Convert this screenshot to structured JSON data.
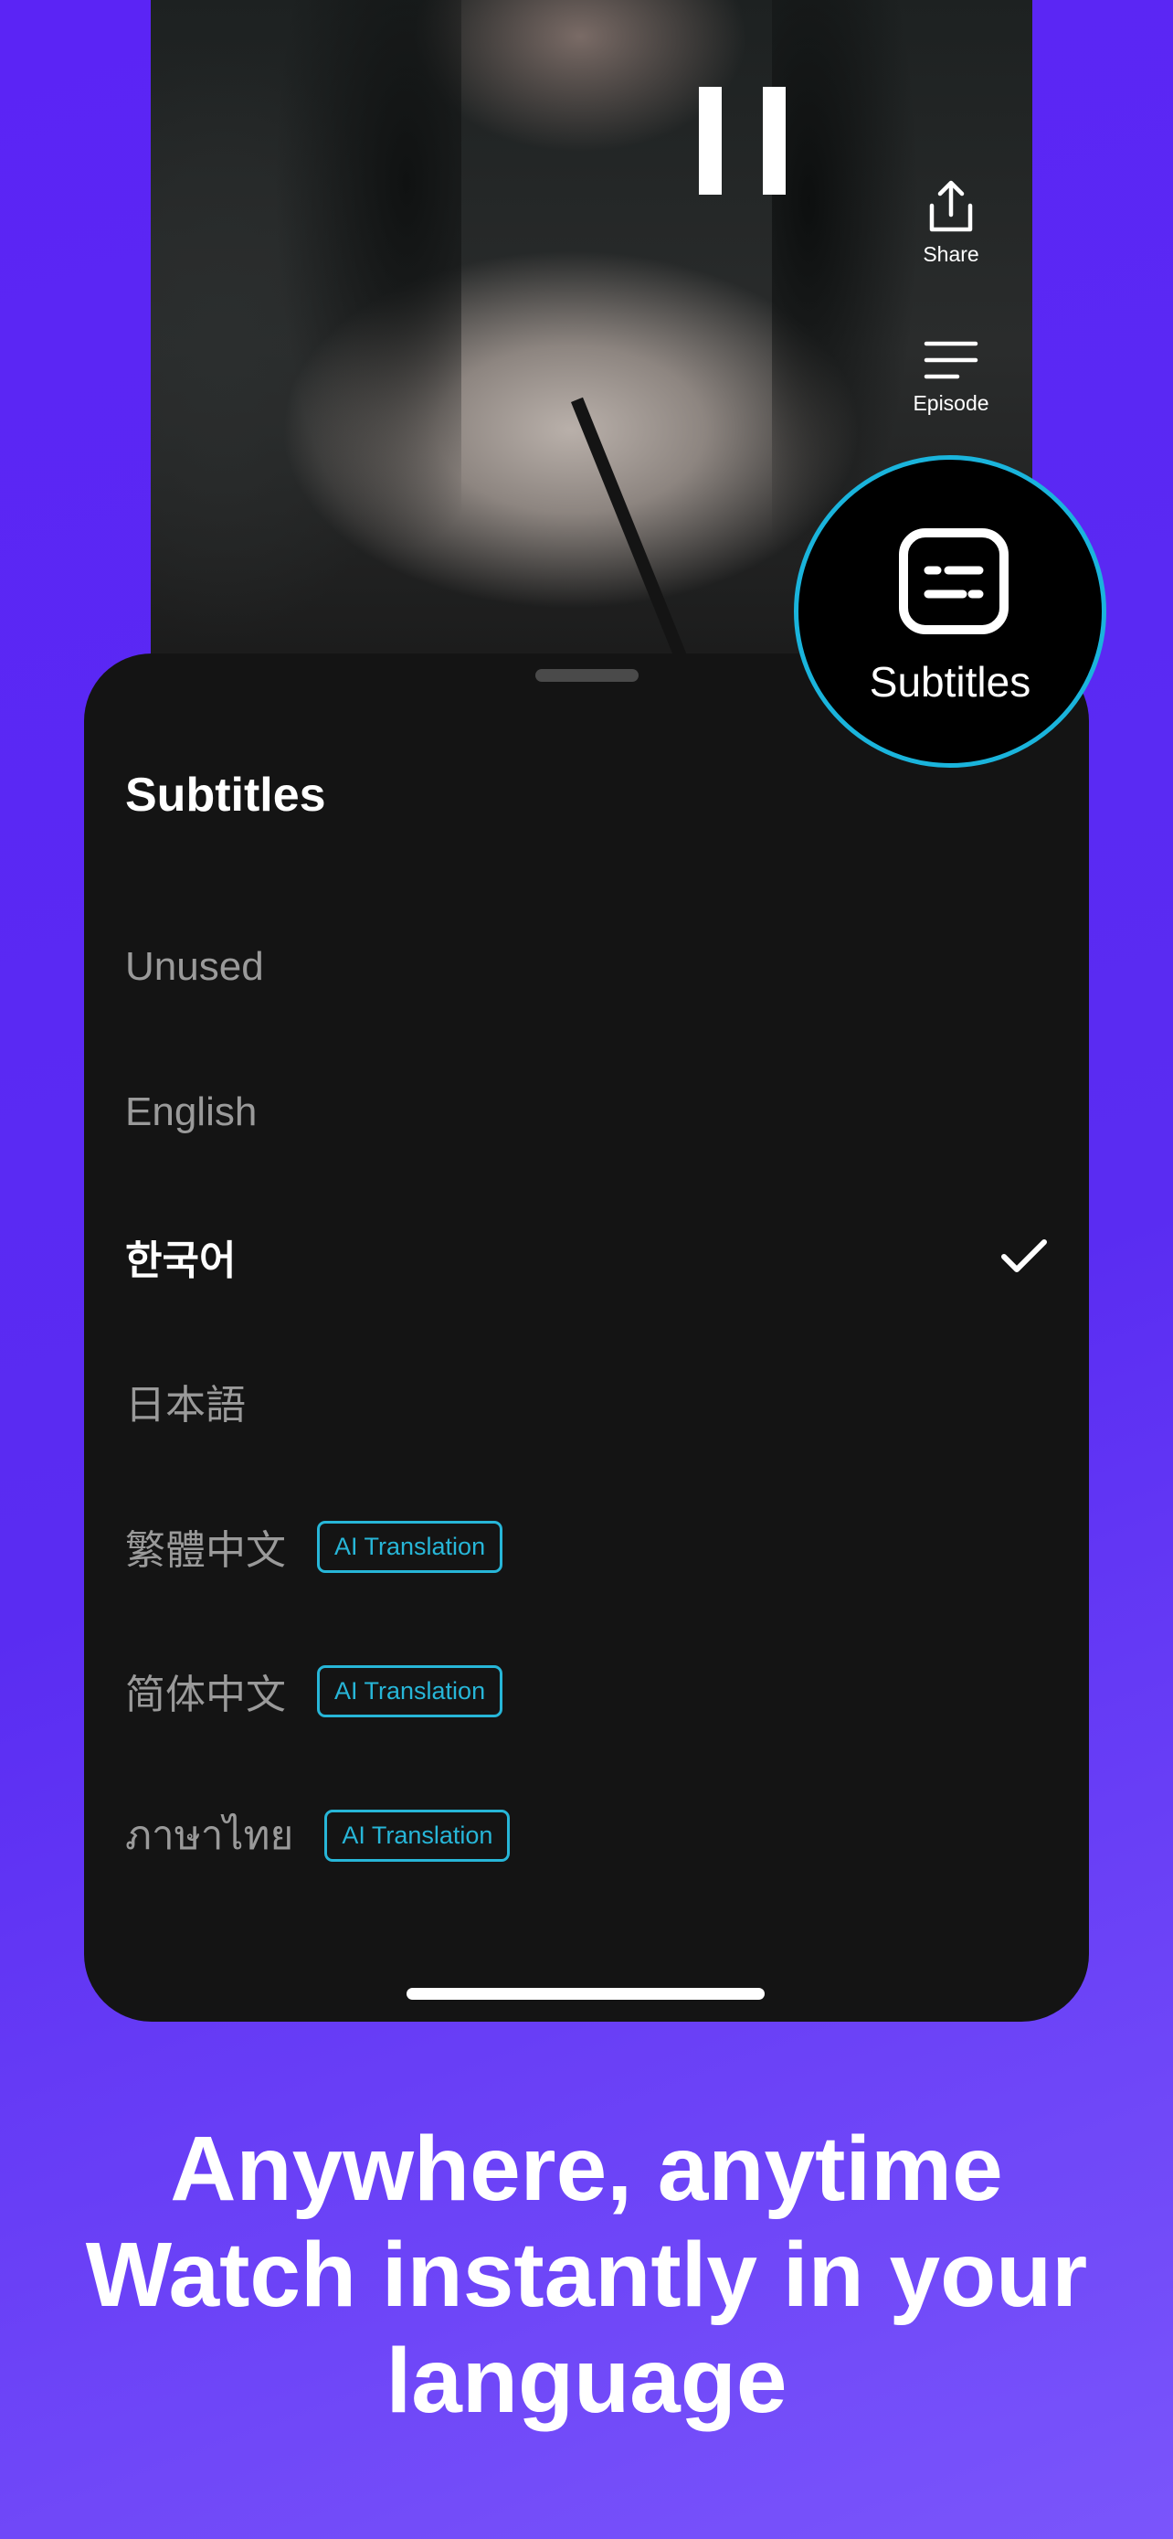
{
  "player": {
    "share_label": "Share",
    "episode_label": "Episode"
  },
  "callout": {
    "label": "Subtitles"
  },
  "subtitles_sheet": {
    "title": "Subtitles",
    "options": [
      {
        "label": "Unused",
        "selected": false,
        "badge": ""
      },
      {
        "label": "English",
        "selected": false,
        "badge": ""
      },
      {
        "label": "한국어",
        "selected": true,
        "badge": ""
      },
      {
        "label": "日本語",
        "selected": false,
        "badge": ""
      },
      {
        "label": "繁體中文",
        "selected": false,
        "badge": "AI Translation"
      },
      {
        "label": "简体中文",
        "selected": false,
        "badge": "AI Translation"
      },
      {
        "label": "ภาษาไทย",
        "selected": false,
        "badge": "AI Translation"
      }
    ]
  },
  "headline": {
    "line1": "Anywhere, anytime",
    "line2": "Watch instantly in your",
    "line3": "language"
  },
  "colors": {
    "background_start": "#5b24f5",
    "background_end": "#7a55fb",
    "sheet": "#141414",
    "accent": "#27b6d8"
  }
}
